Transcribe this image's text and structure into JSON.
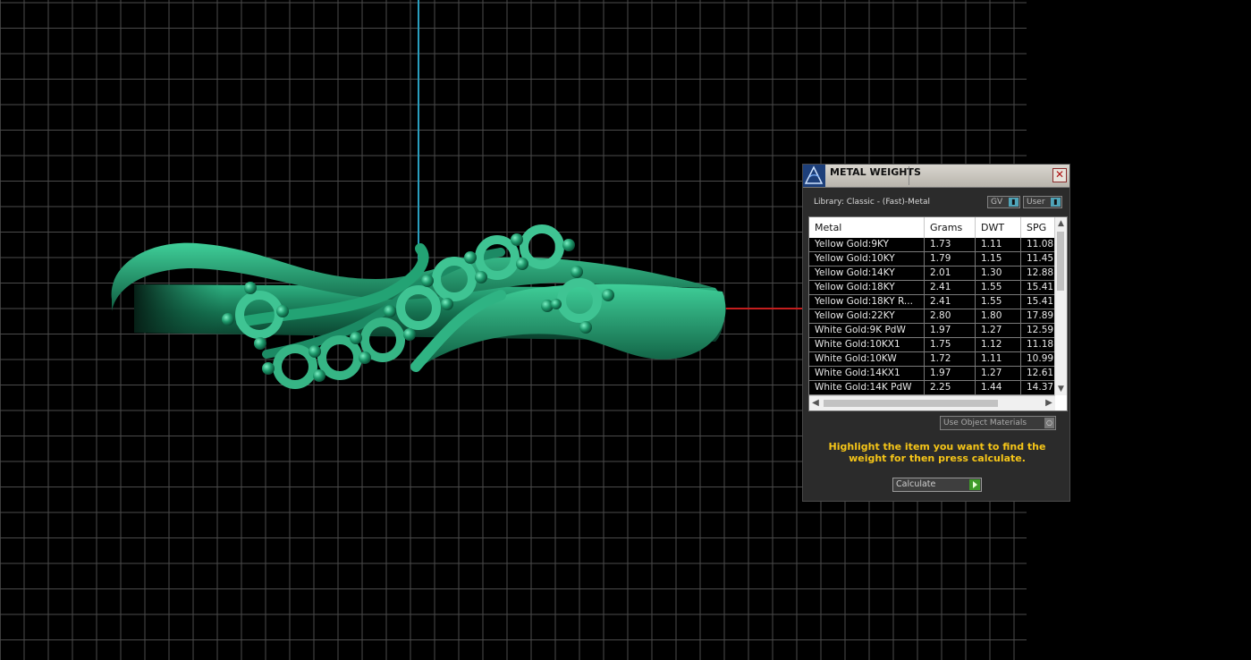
{
  "panel": {
    "title": "METAL WEIGHTS",
    "close_symbol": "✕",
    "library_label": "Library: Classic - (Fast)-Metal",
    "gv_label": "GV",
    "user_label": "User",
    "columns": [
      "Metal",
      "Grams",
      "DWT",
      "SPG"
    ],
    "rows": [
      {
        "metal": "Yellow Gold:9KY",
        "grams": "1.73",
        "dwt": "1.11",
        "spg": "11.08"
      },
      {
        "metal": "Yellow Gold:10KY",
        "grams": "1.79",
        "dwt": "1.15",
        "spg": "11.45"
      },
      {
        "metal": "Yellow Gold:14KY",
        "grams": "2.01",
        "dwt": "1.30",
        "spg": "12.88"
      },
      {
        "metal": "Yellow Gold:18KY",
        "grams": "2.41",
        "dwt": "1.55",
        "spg": "15.41"
      },
      {
        "metal": "Yellow Gold:18KY R...",
        "grams": "2.41",
        "dwt": "1.55",
        "spg": "15.41"
      },
      {
        "metal": "Yellow Gold:22KY",
        "grams": "2.80",
        "dwt": "1.80",
        "spg": "17.89"
      },
      {
        "metal": "White Gold:9K PdW",
        "grams": "1.97",
        "dwt": "1.27",
        "spg": "12.59"
      },
      {
        "metal": "White Gold:10KX1",
        "grams": "1.75",
        "dwt": "1.12",
        "spg": "11.18"
      },
      {
        "metal": "White Gold:10KW",
        "grams": "1.72",
        "dwt": "1.11",
        "spg": "10.99"
      },
      {
        "metal": "White Gold:14KX1",
        "grams": "1.97",
        "dwt": "1.27",
        "spg": "12.61"
      },
      {
        "metal": "White Gold:14K PdW",
        "grams": "2.25",
        "dwt": "1.44",
        "spg": "14.37"
      }
    ],
    "use_object_materials": "Use Object Materials",
    "hint": "Highlight the item you want to find the weight for then press calculate.",
    "calculate_label": "Calculate"
  },
  "icons": {
    "app": "app-logo-icon",
    "close": "close-icon",
    "dropdown": "dropdown-arrow-icon",
    "play": "play-icon"
  },
  "colors": {
    "model": "#1c8a64",
    "hint": "#f5c518",
    "y_axis": "#2a9fbf",
    "x_axis": "#c41e1e",
    "grid": "#5a5a5a"
  }
}
